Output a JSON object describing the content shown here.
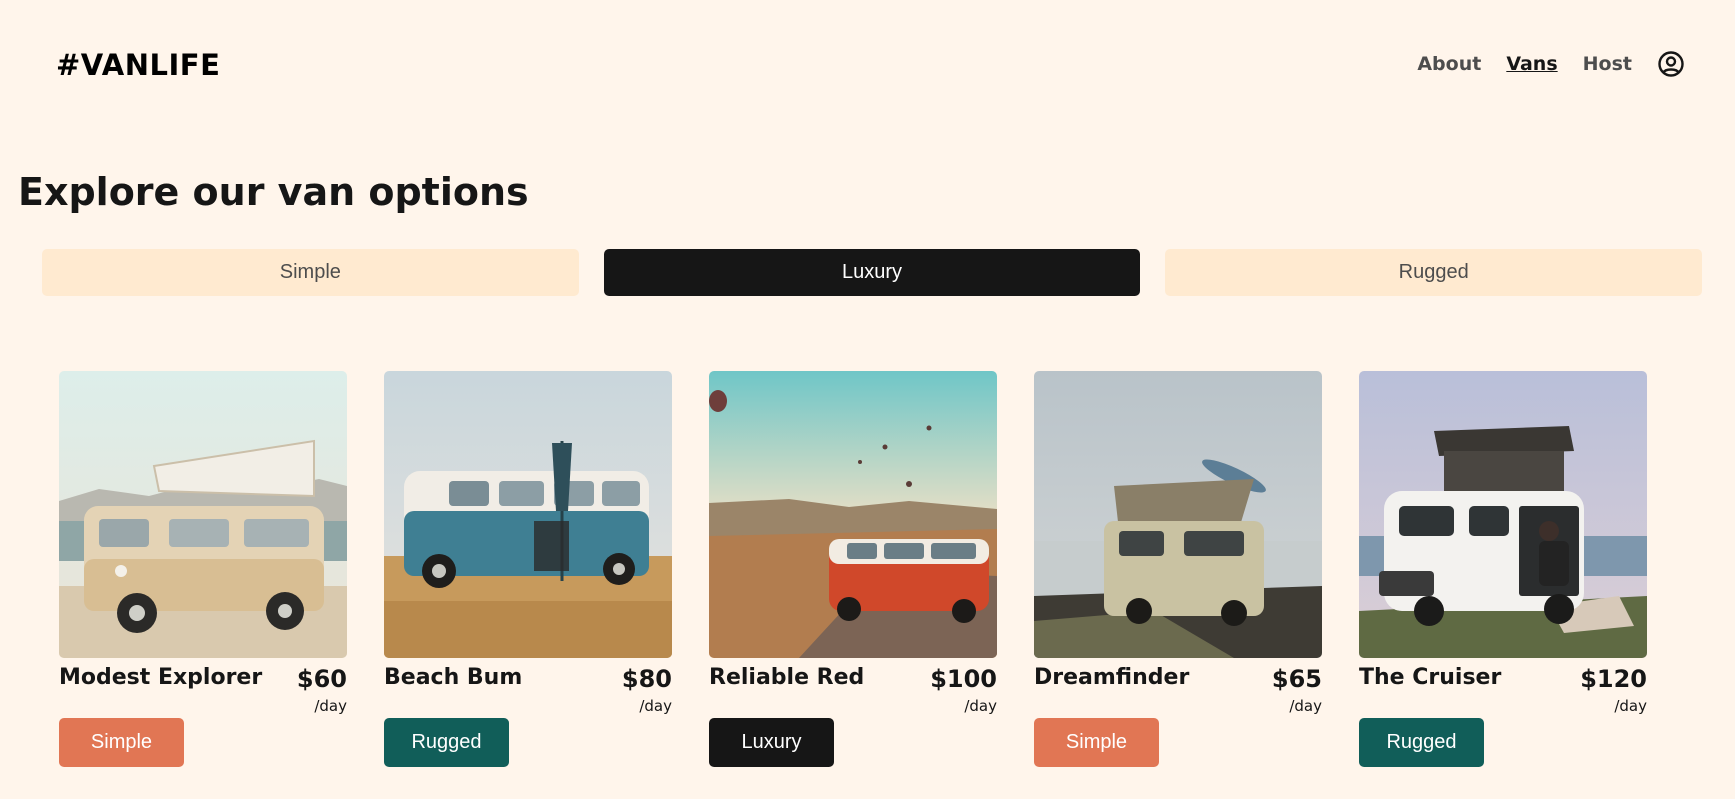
{
  "header": {
    "logo": "#VANLIFE",
    "nav": [
      {
        "label": "About",
        "active": false
      },
      {
        "label": "Vans",
        "active": true
      },
      {
        "label": "Host",
        "active": false
      }
    ],
    "account_icon": "user-circle-icon"
  },
  "main": {
    "title": "Explore our van options",
    "filters": [
      {
        "label": "Simple",
        "selected": false
      },
      {
        "label": "Luxury",
        "selected": true
      },
      {
        "label": "Rugged",
        "selected": false
      }
    ],
    "vans": [
      {
        "name": "Modest Explorer",
        "price": "$60",
        "per": "/day",
        "type": "Simple"
      },
      {
        "name": "Beach Bum",
        "price": "$80",
        "per": "/day",
        "type": "Rugged"
      },
      {
        "name": "Reliable Red",
        "price": "$100",
        "per": "/day",
        "type": "Luxury"
      },
      {
        "name": "Dreamfinder",
        "price": "$65",
        "per": "/day",
        "type": "Simple"
      },
      {
        "name": "The Cruiser",
        "price": "$120",
        "per": "/day",
        "type": "Rugged"
      }
    ]
  },
  "colors": {
    "background": "#FFF5EB",
    "filter_bg": "#FFEAD0",
    "dark": "#161616",
    "simple": "#E17654",
    "rugged": "#115E59",
    "luxury": "#161616"
  }
}
